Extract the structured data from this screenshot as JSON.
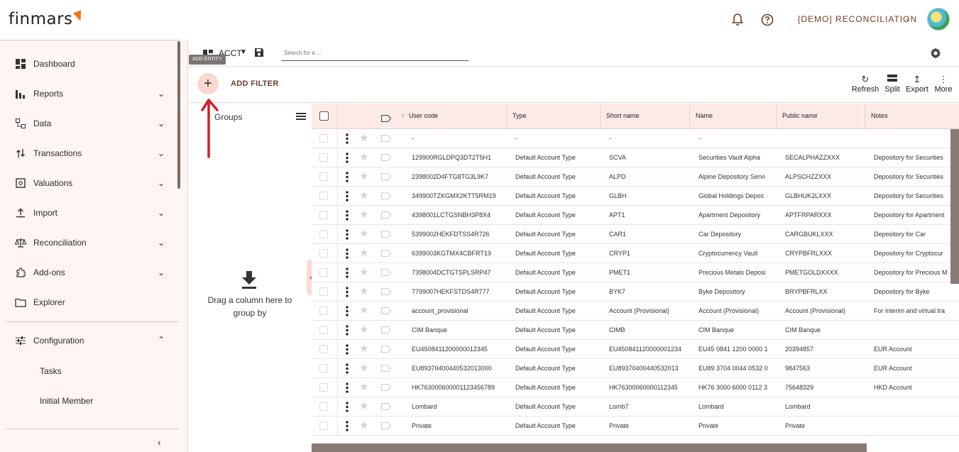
{
  "header": {
    "logo": "finmars",
    "user_menu": "[DEMO] RECONCILIATION",
    "icons": [
      "bell-icon",
      "help-circle-icon",
      "chevron-down-icon",
      "avatar"
    ]
  },
  "sidebar": {
    "items": [
      {
        "label": "Dashboard",
        "icon": "dashboard-icon"
      },
      {
        "label": "Reports",
        "icon": "bar-chart-icon"
      },
      {
        "label": "Data",
        "icon": "data-icon"
      },
      {
        "label": "Transactions",
        "icon": "transactions-icon"
      },
      {
        "label": "Valuations",
        "icon": "valuations-icon"
      },
      {
        "label": "Import",
        "icon": "upload-icon"
      },
      {
        "label": "Reconciliation",
        "icon": "scale-icon"
      },
      {
        "label": "Add-ons",
        "icon": "puzzle-icon"
      },
      {
        "label": "Explorer",
        "icon": "folder-icon"
      },
      {
        "label": "Configuration",
        "icon": "sliders-icon"
      }
    ],
    "sub_items": [
      "Tasks",
      "Initial Member"
    ]
  },
  "toolbar": {
    "layout_name": "ACCT",
    "search_placeholder": "Search for a ...",
    "tooltip": "ADD ENTITY",
    "add_filter": "ADD FILTER",
    "actions": [
      {
        "label": "Refresh",
        "icon": "refresh-icon"
      },
      {
        "label": "Split",
        "icon": "split-icon"
      },
      {
        "label": "Export",
        "icon": "export-icon"
      },
      {
        "label": "More",
        "icon": "more-vertical-icon"
      }
    ]
  },
  "groups": {
    "title": "Groups",
    "hint": "Drag a column here to group by"
  },
  "grid": {
    "columns": [
      "User code",
      "Type",
      "Short name",
      "Name",
      "Public name",
      "Notes"
    ],
    "rows": [
      [
        "-",
        "-",
        "-",
        "-",
        "",
        ""
      ],
      [
        "129900RGLDPQ3DT2T5H1",
        "Default Account Type",
        "SCVA",
        "Securities Vault Alpha",
        "SECALPHAZZXXX",
        "Depository for Securities"
      ],
      [
        "2398002D4FTG8TG3L9K7",
        "Default Account Type",
        "ALPD",
        "Alpine Depository Servi",
        "ALPSCHZZXXX",
        "Depository for Securities"
      ],
      [
        "349900TZKGMX2KTT5RM19",
        "Default Account Type",
        "GLBH",
        "Global Holdings Depos",
        "GLBHUK2LXXX",
        "Depository for Securities"
      ],
      [
        "4398001LCTGSNBH3P8X4",
        "Default Account Type",
        "APT1",
        "Apartment Depository",
        "APTFRPARXXX",
        "Depository for Apartment"
      ],
      [
        "5399002HEKFDTSS4R726",
        "Default Account Type",
        "CAR1",
        "Car Depository",
        "CARGBUKLXXX",
        "Depository for Car"
      ],
      [
        "6399003KGTMX4CBFRT19",
        "Default Account Type",
        "CRYP1",
        "Cryptocurrency Vault",
        "CRYPBFRLXXX",
        "Depository for Cryptocur"
      ],
      [
        "7398004DCTGTSPLSRP47",
        "Default Account Type",
        "PMET1",
        "Precious Metals Deposi",
        "PMETGOLDXXXX",
        "Depository for Precious M"
      ],
      [
        "7799007HEKFSTDS4R777",
        "Default Account Type",
        "BYK7",
        "Byke Depository",
        "BRYPBFRLXX",
        "Depository for Byke"
      ],
      [
        "account_provisional",
        "Default Account Type",
        "Account (Provisional)",
        "Account (Provisional)",
        "Account (Provisional)",
        "For interim and virtual tra"
      ],
      [
        "CIM Banque",
        "Default Account Type",
        "CIMB",
        "CIM Banque",
        "CIM Banque",
        ""
      ],
      [
        "EU450841120000001234​5",
        "Default Account Type",
        "EU450841120000001234",
        "EU45 0841 1200 0000 1",
        "20394857",
        "EUR Account"
      ],
      [
        "EU8937040044053201300​0",
        "Default Account Type",
        "EU89370400440532013",
        "EU89 3704 0044 0532 0",
        "9847563",
        "EUR Account"
      ],
      [
        "HK763000600001123456789",
        "Default Account Type",
        "HK76300060000112345",
        "HK76 3000 6000 0112 3",
        "75648329",
        "HKD Account"
      ],
      [
        "Lombard",
        "Default Account Type",
        "Lomb7",
        "Lombard",
        "Lombard",
        ""
      ],
      [
        "Private",
        "Default Account Type",
        "Private",
        "Private",
        "Private",
        ""
      ]
    ]
  }
}
